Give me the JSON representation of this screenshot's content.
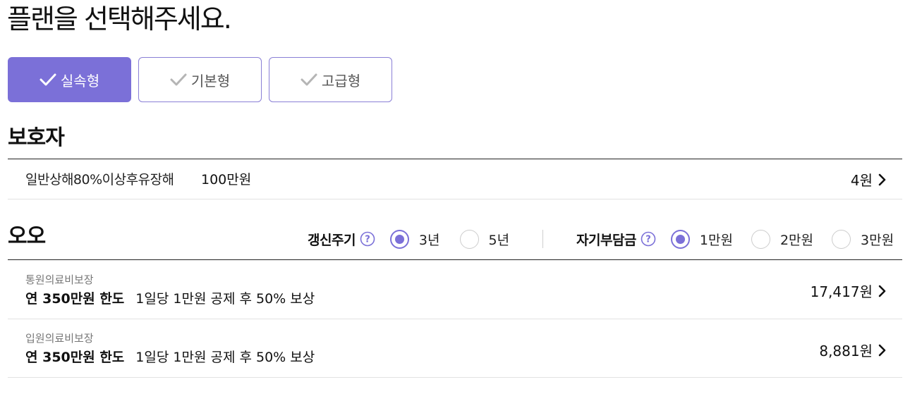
{
  "heading": "플랜을 선택해주세요.",
  "plans": [
    {
      "label": "실속형",
      "selected": true
    },
    {
      "label": "기본형",
      "selected": false
    },
    {
      "label": "고급형",
      "selected": false
    }
  ],
  "guardian": {
    "title": "보호자",
    "row": {
      "label": "일반상해80%이상후유장해",
      "amount": "100만원",
      "price": "4원"
    }
  },
  "section2": {
    "title": "오오",
    "renewal": {
      "label": "갱신주기",
      "options": [
        {
          "label": "3년",
          "selected": true
        },
        {
          "label": "5년",
          "selected": false
        }
      ]
    },
    "deductible": {
      "label": "자기부담금",
      "options": [
        {
          "label": "1만원",
          "selected": true
        },
        {
          "label": "2만원",
          "selected": false
        },
        {
          "label": "3만원",
          "selected": false
        }
      ]
    },
    "items": [
      {
        "sub": "통원의료비보장",
        "limit": "연 350만원 한도",
        "detail": "1일당 1만원 공제 후 50% 보상",
        "price": "17,417원"
      },
      {
        "sub": "입원의료비보장",
        "limit": "연 350만원 한도",
        "detail": "1일당 1만원 공제 후 50% 보상",
        "price": "8,881원"
      }
    ]
  },
  "colors": {
    "accent": "#7b70d8",
    "text": "#111111",
    "muted": "#777777",
    "divider": "#e2e2e2"
  },
  "icons": {
    "check": "check-icon",
    "help": "question-circle-icon",
    "chevron": "chevron-right-icon"
  }
}
